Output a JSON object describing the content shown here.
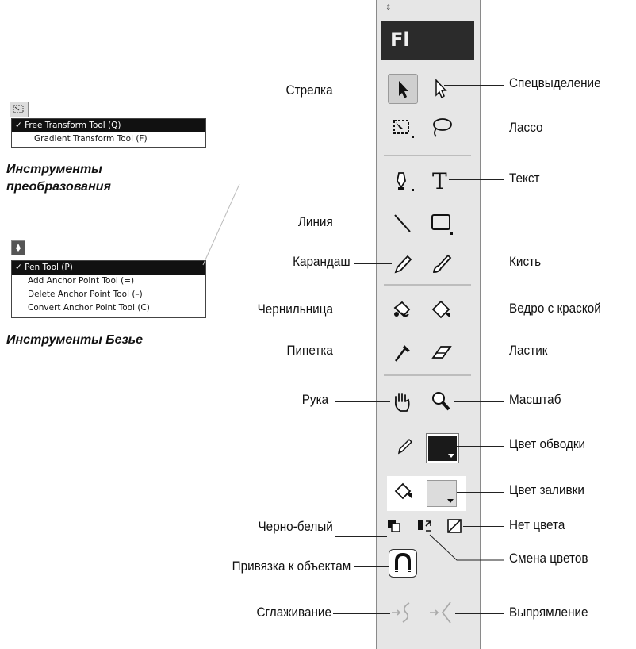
{
  "app": {
    "logo": "Fl"
  },
  "left_labels": {
    "arrow": "Стрелка",
    "line": "Линия",
    "pencil": "Карандаш",
    "ink_bottle": "Чернильница",
    "eyedropper": "Пипетка",
    "hand": "Рука",
    "black_white": "Черно-белый",
    "snap": "Привязка к объектам",
    "smooth": "Сглаживание"
  },
  "right_labels": {
    "subselect": "Спецвыделение",
    "lasso": "Лассо",
    "text": "Текст",
    "brush": "Кисть",
    "paint_bucket": "Ведро с краской",
    "eraser": "Ластик",
    "zoom": "Масштаб",
    "stroke_color": "Цвет обводки",
    "fill_color": "Цвет заливки",
    "no_color": "Нет цвета",
    "swap_colors": "Смена цветов",
    "straighten": "Выпрямление"
  },
  "transform_popup": {
    "items": [
      "✓ Free Transform Tool (Q)",
      "Gradient Transform Tool (F)"
    ],
    "caption_line1": "Инструменты",
    "caption_line2": "преобразования"
  },
  "bezier_popup": {
    "items": [
      "✓ Pen Tool (P)",
      "Add Anchor Point Tool (=)",
      "Delete Anchor Point Tool (–)",
      "Convert Anchor Point Tool (C)"
    ],
    "caption": "Инструменты Безье"
  },
  "colors": {
    "panel_bg": "#e6e6e6",
    "header_bg": "#2b2b2b",
    "stroke_swatch": "#1a1a1a",
    "fill_swatch": "#dcdcdc"
  }
}
